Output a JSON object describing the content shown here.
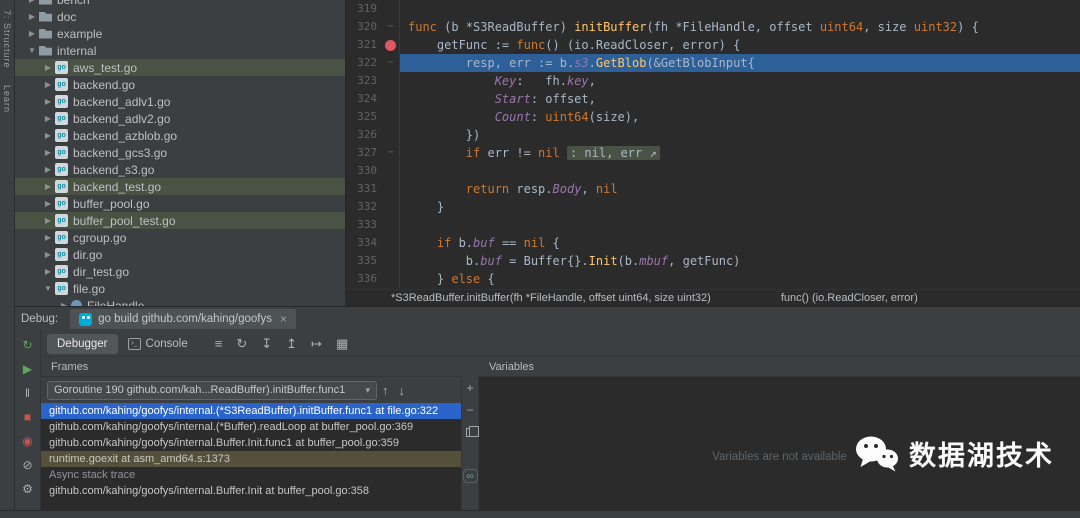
{
  "stripes": {
    "left": [
      {
        "label": "7: Structure"
      },
      {
        "label": "Learn"
      }
    ]
  },
  "project": {
    "items": [
      {
        "label": "bench",
        "kind": "folder",
        "level": 0,
        "arrow": "▶",
        "clip": "top"
      },
      {
        "label": "doc",
        "kind": "folder",
        "level": 0,
        "arrow": "▶"
      },
      {
        "label": "example",
        "kind": "folder",
        "level": 0,
        "arrow": "▶"
      },
      {
        "label": "internal",
        "kind": "folder",
        "level": 0,
        "arrow": "▼"
      },
      {
        "label": "aws_test.go",
        "kind": "go",
        "level": 1,
        "arrow": "▶",
        "hl": true
      },
      {
        "label": "backend.go",
        "kind": "go",
        "level": 1,
        "arrow": "▶"
      },
      {
        "label": "backend_adlv1.go",
        "kind": "go",
        "level": 1,
        "arrow": "▶"
      },
      {
        "label": "backend_adlv2.go",
        "kind": "go",
        "level": 1,
        "arrow": "▶"
      },
      {
        "label": "backend_azblob.go",
        "kind": "go",
        "level": 1,
        "arrow": "▶"
      },
      {
        "label": "backend_gcs3.go",
        "kind": "go",
        "level": 1,
        "arrow": "▶"
      },
      {
        "label": "backend_s3.go",
        "kind": "go",
        "level": 1,
        "arrow": "▶"
      },
      {
        "label": "backend_test.go",
        "kind": "go",
        "level": 1,
        "arrow": "▶",
        "hl": true
      },
      {
        "label": "buffer_pool.go",
        "kind": "go",
        "level": 1,
        "arrow": "▶"
      },
      {
        "label": "buffer_pool_test.go",
        "kind": "go",
        "level": 1,
        "arrow": "▶",
        "hl": true
      },
      {
        "label": "cgroup.go",
        "kind": "go",
        "level": 1,
        "arrow": "▶"
      },
      {
        "label": "dir.go",
        "kind": "go",
        "level": 1,
        "arrow": "▶"
      },
      {
        "label": "dir_test.go",
        "kind": "go",
        "level": 1,
        "arrow": "▶"
      },
      {
        "label": "file.go",
        "kind": "go",
        "level": 1,
        "arrow": "▼"
      },
      {
        "label": "FileHandle",
        "kind": "type",
        "level": 2,
        "arrow": "▶",
        "clip": "bottom"
      }
    ]
  },
  "editor": {
    "lines": [
      {
        "n": "319",
        "t": []
      },
      {
        "n": "320",
        "fold": true,
        "t": [
          [
            "k",
            "func"
          ],
          [
            "d",
            " (b *S3ReadBuffer) "
          ],
          [
            "f",
            "initBuffer"
          ],
          [
            "d",
            "(fh *FileHandle, offset "
          ],
          [
            "k",
            "uint64"
          ],
          [
            "d",
            ", size "
          ],
          [
            "k",
            "uint32"
          ],
          [
            "d",
            ") {"
          ]
        ]
      },
      {
        "n": "321",
        "bp": true,
        "t": [
          [
            "d",
            "    getFunc := "
          ],
          [
            "k",
            "func"
          ],
          [
            "d",
            "() (io.ReadCloser, error) {"
          ]
        ]
      },
      {
        "n": "322",
        "exec": true,
        "fold": true,
        "t": [
          [
            "d",
            "        resp, err := b."
          ],
          [
            "p",
            "s3"
          ],
          [
            "d",
            "."
          ],
          [
            "f",
            "GetBlob"
          ],
          [
            "d",
            "(&GetBlobInput{"
          ]
        ]
      },
      {
        "n": "323",
        "t": [
          [
            "d",
            "            "
          ],
          [
            "p",
            "Key"
          ],
          [
            "d",
            ":   fh."
          ],
          [
            "p",
            "key"
          ],
          [
            "d",
            ","
          ]
        ]
      },
      {
        "n": "324",
        "t": [
          [
            "d",
            "            "
          ],
          [
            "p",
            "Start"
          ],
          [
            "d",
            ": offset,"
          ]
        ]
      },
      {
        "n": "325",
        "t": [
          [
            "d",
            "            "
          ],
          [
            "p",
            "Count"
          ],
          [
            "d",
            ": "
          ],
          [
            "k",
            "uint64"
          ],
          [
            "d",
            "(size),"
          ]
        ]
      },
      {
        "n": "326",
        "t": [
          [
            "d",
            "        })"
          ]
        ]
      },
      {
        "n": "327",
        "fold": true,
        "t": [
          [
            "d",
            "        "
          ],
          [
            "k",
            "if"
          ],
          [
            "d",
            " err != "
          ],
          [
            "k",
            "nil"
          ],
          [
            "d",
            " "
          ],
          [
            "x",
            ": nil, err ↗"
          ]
        ]
      },
      {
        "n": "330",
        "t": []
      },
      {
        "n": "331",
        "t": [
          [
            "d",
            "        "
          ],
          [
            "k",
            "return"
          ],
          [
            "d",
            " resp."
          ],
          [
            "p",
            "Body"
          ],
          [
            "d",
            ", "
          ],
          [
            "k",
            "nil"
          ]
        ]
      },
      {
        "n": "332",
        "t": [
          [
            "d",
            "    }"
          ]
        ]
      },
      {
        "n": "333",
        "t": []
      },
      {
        "n": "334",
        "t": [
          [
            "d",
            "    "
          ],
          [
            "k",
            "if"
          ],
          [
            "d",
            " b."
          ],
          [
            "p",
            "buf"
          ],
          [
            "d",
            " == "
          ],
          [
            "k",
            "nil"
          ],
          [
            "d",
            " {"
          ]
        ]
      },
      {
        "n": "335",
        "t": [
          [
            "d",
            "        b."
          ],
          [
            "p",
            "buf"
          ],
          [
            "d",
            " = Buffer{}."
          ],
          [
            "f",
            "Init"
          ],
          [
            "d",
            "(b."
          ],
          [
            "p",
            "mbuf"
          ],
          [
            "d",
            ", getFunc)"
          ]
        ]
      },
      {
        "n": "336",
        "t": [
          [
            "d",
            "    } "
          ],
          [
            "k",
            "else"
          ],
          [
            "d",
            " {"
          ]
        ]
      }
    ]
  },
  "context_bar": {
    "signature": "*S3ReadBuffer.initBuffer(fh *FileHandle, offset uint64, size uint32)",
    "return_type": "func() (io.ReadCloser, error)"
  },
  "debug": {
    "label": "Debug:",
    "session_tab": {
      "title": "go build github.com/kahing/goofys",
      "close": "×"
    },
    "tabs": [
      {
        "label": "Debugger",
        "selected": true
      },
      {
        "label": "Console",
        "selected": false,
        "icon_glyph": ">_"
      }
    ],
    "toolbar_icons": [
      {
        "name": "hamburger-menu-icon",
        "glyph": "≡",
        "c": "c-gray"
      },
      {
        "name": "restore-layout-icon",
        "glyph": "↻",
        "c": "c-gray"
      },
      {
        "name": "step-into-icon",
        "glyph": "↧",
        "c": "c-gray"
      },
      {
        "name": "step-out-icon",
        "glyph": "↥",
        "c": "c-gray"
      },
      {
        "name": "run-to-cursor-icon",
        "glyph": "↦",
        "c": "c-gray"
      },
      {
        "name": "layout-grid-icon",
        "glyph": "▦",
        "c": "c-gray"
      }
    ],
    "left_icons": [
      {
        "name": "rerun-icon",
        "glyph": "↻",
        "c": "c-green"
      },
      {
        "name": "resume-icon",
        "glyph": "▶",
        "c": "c-green"
      },
      {
        "name": "pause-icon",
        "glyph": "‖",
        "c": "c-gray"
      },
      {
        "name": "stop-icon",
        "glyph": "■",
        "c": "c-red"
      },
      {
        "name": "view-breakpoints-icon",
        "glyph": "◉",
        "c": "c-red"
      },
      {
        "name": "mute-breakpoints-icon",
        "glyph": "⊘",
        "c": "c-gray"
      },
      {
        "name": "settings-gear-icon",
        "glyph": "⚙",
        "c": "c-gray"
      }
    ],
    "frames": {
      "header": "Frames",
      "thread_selector": {
        "value": "Goroutine 190 github.com/kah...ReadBuffer).initBuffer.func1",
        "caret": "▾"
      },
      "nav_icons": [
        {
          "name": "previous-frame-icon",
          "glyph": "↑"
        },
        {
          "name": "next-frame-icon",
          "glyph": "↓"
        }
      ],
      "rows": [
        {
          "text": "github.com/kahing/goofys/internal.(*S3ReadBuffer).initBuffer.func1 at file.go:322",
          "style": "selected"
        },
        {
          "text": "github.com/kahing/goofys/internal.(*Buffer).readLoop at buffer_pool.go:369",
          "style": "normal"
        },
        {
          "text": "github.com/kahing/goofys/internal.Buffer.Init.func1 at buffer_pool.go:359",
          "style": "normal"
        },
        {
          "text": "runtime.goexit at asm_amd64.s:1373",
          "style": "library"
        },
        {
          "text": "Async stack trace",
          "style": "section"
        },
        {
          "text": "github.com/kahing/goofys/internal.Buffer.Init at buffer_pool.go:358",
          "style": "normal"
        }
      ]
    },
    "side_icons": [
      {
        "name": "add-watch-icon",
        "glyph": "+"
      },
      {
        "name": "remove-watch-icon",
        "glyph": "−"
      },
      {
        "name": "copy-frames-icon",
        "glyph": "copy"
      },
      {
        "name": "evaluate-endless-icon",
        "glyph": "∞"
      }
    ],
    "variables": {
      "header": "Variables",
      "empty_text": "Variables are not available"
    }
  },
  "watermark": {
    "text": "数据湖技术"
  },
  "colors": {
    "accent_blue": "#2b64c9",
    "execution_line": "#2d6099",
    "breakpoint_red": "#db5860",
    "go_brand": "#00add8",
    "library_frame_bg": "#55503a",
    "test_file_row": "#4a5343"
  }
}
